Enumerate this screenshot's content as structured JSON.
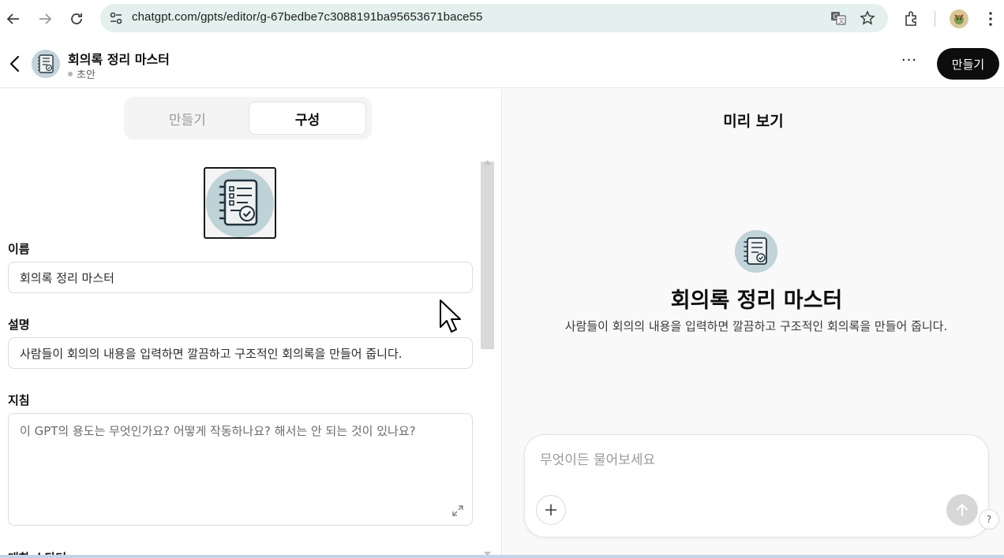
{
  "browser": {
    "url": "chatgpt.com/gpts/editor/g-67bedbe7c3088191ba95653671bace55",
    "url_bar_color": "#e3f0ed",
    "icons": [
      "back-arrow-icon",
      "forward-arrow-icon",
      "reload-icon",
      "site-settings-icon",
      "translate-icon",
      "bookmark-star-icon",
      "extensions-icon",
      "profile-avatar-icon",
      "kebab-menu-icon"
    ]
  },
  "header": {
    "title": "회의록 정리 마스터",
    "status": "초안",
    "create_label": "만들기",
    "more_label": "···"
  },
  "editor": {
    "tabs": [
      {
        "label": "만들기",
        "active": false
      },
      {
        "label": "구성",
        "active": true
      }
    ],
    "name_label": "이름",
    "name_value": "회의록 정리 마스터",
    "description_label": "설명",
    "description_value": "사람들이 회의의 내용을 입력하면 깔끔하고 구조적인 회의록을 만들어 줍니다.",
    "instructions_label": "지침",
    "instructions_placeholder": "이 GPT의 용도는 무엇인가요? 어떻게 작동하나요? 해서는 안 되는 것이 있나요?",
    "next_label_partial": "대화 스타터"
  },
  "preview": {
    "title": "미리 보기",
    "gpt_name": "회의록 정리 마스터",
    "gpt_description": "사람들이 회의의 내용을 입력하면 깔끔하고 구조적인 회의록을 만들어 줍니다.",
    "composer_placeholder": "무엇이든 물어보세요",
    "help_label": "?"
  }
}
